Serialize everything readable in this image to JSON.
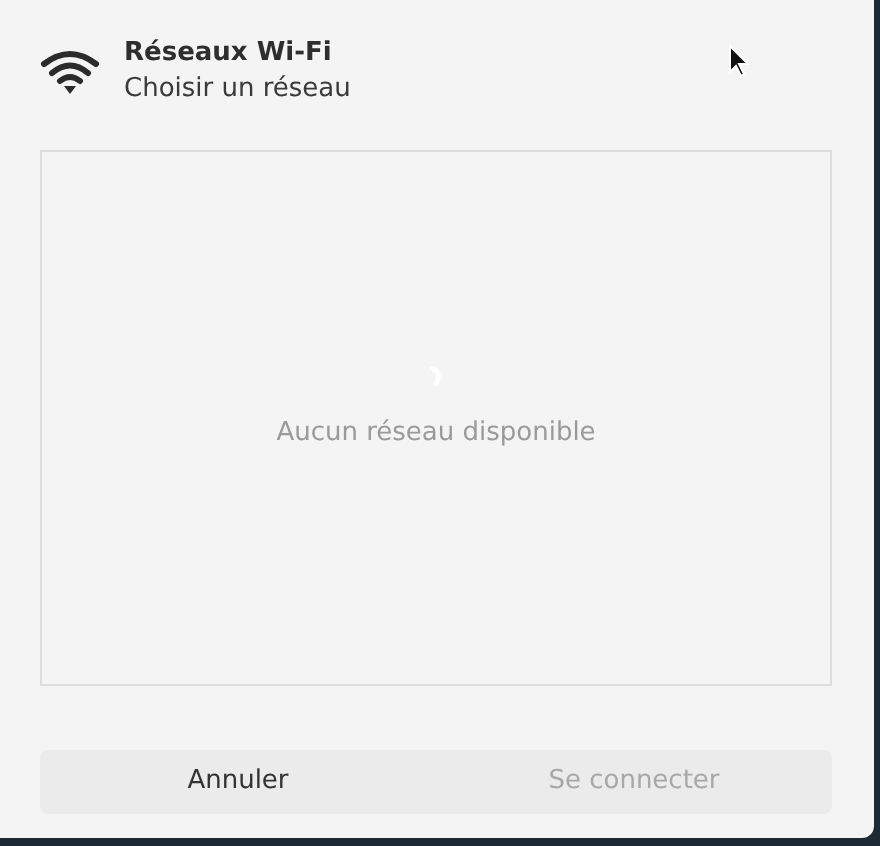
{
  "header": {
    "title": "Réseaux Wi-Fi",
    "subtitle": "Choisir un réseau"
  },
  "network_list": {
    "loading": true,
    "empty_message": "Aucun réseau disponible"
  },
  "buttons": [
    {
      "label": "Annuler",
      "disabled": false
    },
    {
      "label": "Se connecter",
      "disabled": true
    }
  ]
}
